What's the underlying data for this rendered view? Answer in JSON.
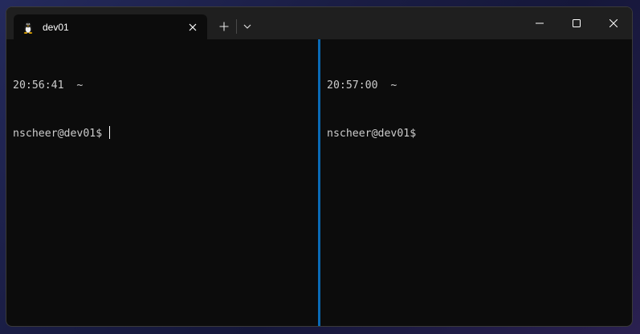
{
  "window": {
    "tab": {
      "title": "dev01",
      "icon": "linux-tux-icon"
    },
    "controls": {
      "new_tab": "+",
      "dropdown": "chevron-down-icon",
      "minimize": "minimize-icon",
      "maximize": "maximize-icon",
      "close": "close-icon"
    },
    "accent_color": "#0a6ab6"
  },
  "panes": [
    {
      "time_line": "20:56:41  ~",
      "prompt": "nscheer@dev01$",
      "has_cursor": true
    },
    {
      "time_line": "20:57:00  ~",
      "prompt": "nscheer@dev01$",
      "has_cursor": false
    }
  ]
}
